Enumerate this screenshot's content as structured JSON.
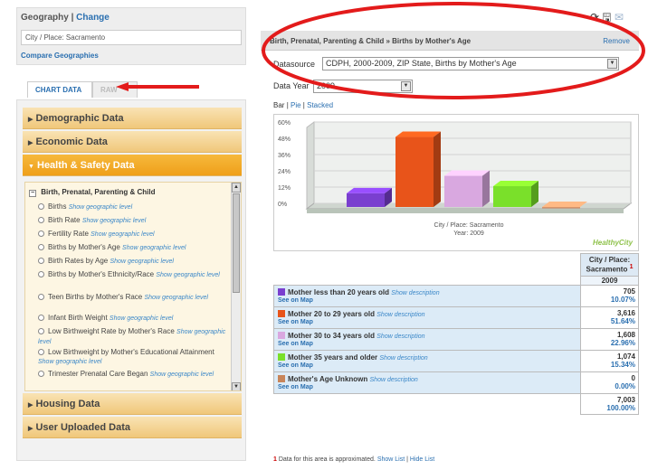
{
  "geography": {
    "title": "Geography",
    "separator": "|",
    "change_label": "Change",
    "selected": "City / Place: Sacramento",
    "compare_label": "Compare Geographies"
  },
  "tabs": [
    {
      "label": "CHART DATA"
    },
    {
      "label": "RAW"
    }
  ],
  "sections": [
    {
      "label": "Demographic Data"
    },
    {
      "label": "Economic Data"
    },
    {
      "label": "Health & Safety Data"
    },
    {
      "label": "Housing Data"
    },
    {
      "label": "User Uploaded Data"
    }
  ],
  "expand_glyph": "▶",
  "collapse_glyph": "▼",
  "category": {
    "toggle": "−",
    "title": "Birth, Prenatal, Parenting & Child",
    "show_level_label": "Show geographic level",
    "items": [
      {
        "label": "Births"
      },
      {
        "label": "Birth Rate"
      },
      {
        "label": "Fertility Rate"
      },
      {
        "label": "Births by Mother's Age"
      },
      {
        "label": "Birth Rates by Age"
      },
      {
        "label": "Births by Mother's Ethnicity/Race"
      },
      {
        "label": "Teen Births by Mother's Race"
      },
      {
        "label": "Infant Birth Weight"
      },
      {
        "label": "Low Birthweight Rate by Mother's Race"
      },
      {
        "label": "Low Birthweight by Mother's Educational Attainment"
      },
      {
        "label": "Trimester Prenatal Care Began"
      }
    ]
  },
  "header": {
    "breadcrumb": "Birth, Prenatal, Parenting & Child » Births by Mother's Age",
    "remove_label": "Remove"
  },
  "datasource": {
    "label": "Datasource",
    "value": "CDPH, 2000-2009, ZIP State, Births by Mother's Age"
  },
  "datayear": {
    "label": "Data Year",
    "value": "2009"
  },
  "chart_types": {
    "bar": "Bar",
    "pie": "Pie",
    "stacked": "Stacked",
    "sep": "|"
  },
  "chart_data": {
    "type": "bar",
    "categories": [
      "Mother less than 20 years old",
      "Mother 20 to 29 years old",
      "Mother 30 to 34 years old",
      "Mother 35 years and older",
      "Mother's Age Unknown"
    ],
    "values": [
      10.07,
      51.64,
      22.96,
      15.34,
      0.0
    ],
    "colors": [
      "#7a3fcf",
      "#e8541a",
      "#d9a8e0",
      "#7ae02a",
      "#d9956a"
    ],
    "yticks": [
      "60%",
      "48%",
      "36%",
      "24%",
      "12%",
      "0%"
    ],
    "ylim": [
      0,
      60
    ],
    "caption_line1": "City / Place: Sacramento",
    "caption_line2": "Year: 2009",
    "watermark": "HealthyCity"
  },
  "table": {
    "col_header": "City / Place: Sacramento",
    "approx_marker": "1",
    "year": "2009",
    "show_desc": "Show description",
    "see_map": "See on Map",
    "rows": [
      {
        "label": "Mother less than 20 years old",
        "count": "705",
        "pct": "10.07%",
        "color": "#7a3fcf"
      },
      {
        "label": "Mother 20 to 29 years old",
        "count": "3,616",
        "pct": "51.64%",
        "color": "#e8541a"
      },
      {
        "label": "Mother 30 to 34 years old",
        "count": "1,608",
        "pct": "22.96%",
        "color": "#d9a8e0"
      },
      {
        "label": "Mother 35 years and older",
        "count": "1,074",
        "pct": "15.34%",
        "color": "#7ae02a"
      },
      {
        "label": "Mother's Age Unknown",
        "count": "0",
        "pct": "0.00%",
        "color": "#c8855a"
      }
    ],
    "total_count": "7,003",
    "total_pct": "100.00%"
  },
  "footnote": {
    "marker": "1",
    "text": "Data for this area is approximated.",
    "show_list": "Show List",
    "sep": "|",
    "hide_list": "Hide List"
  }
}
